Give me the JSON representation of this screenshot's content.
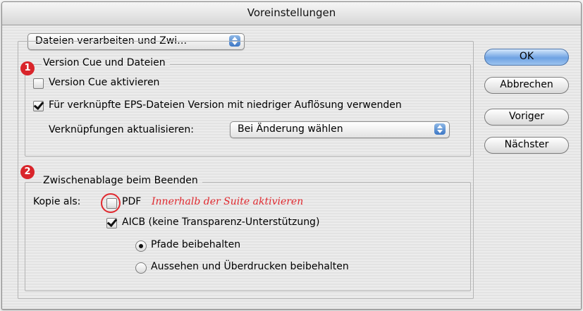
{
  "window": {
    "title": "Voreinstellungen"
  },
  "section_popup": {
    "value": "Dateien verarbeiten und Zwi…"
  },
  "version_cue": {
    "legend": "Version Cue und Dateien",
    "badge": "1",
    "activate_label": "Version Cue aktivieren",
    "activate_checked": false,
    "eps_label": "Für verknüpfte EPS-Dateien Version mit niedriger Auflösung verwenden",
    "eps_checked": true,
    "update_links_label": "Verknüpfungen aktualisieren:",
    "update_links_value": "Bei Änderung wählen"
  },
  "clipboard": {
    "legend": "Zwischenablage beim Beenden",
    "badge": "2",
    "copy_as_label": "Kopie als:",
    "pdf_label": "PDF",
    "pdf_checked": false,
    "pdf_annotation": "Innerhalb der Suite aktivieren",
    "aicb_label": "AICB (keine Transparenz-Unterstützung)",
    "aicb_checked": true,
    "radio_paths": "Pfade beibehalten",
    "radio_paths_selected": true,
    "radio_appearance": "Aussehen und Überdrucken beibehalten",
    "radio_appearance_selected": false
  },
  "buttons": {
    "ok": "OK",
    "cancel": "Abbrechen",
    "previous": "Voriger",
    "next": "Nächster"
  },
  "colors": {
    "annotation_red": "#e0282e",
    "badge_red": "#d9242a",
    "default_button_blue": "#6ea2e3"
  }
}
